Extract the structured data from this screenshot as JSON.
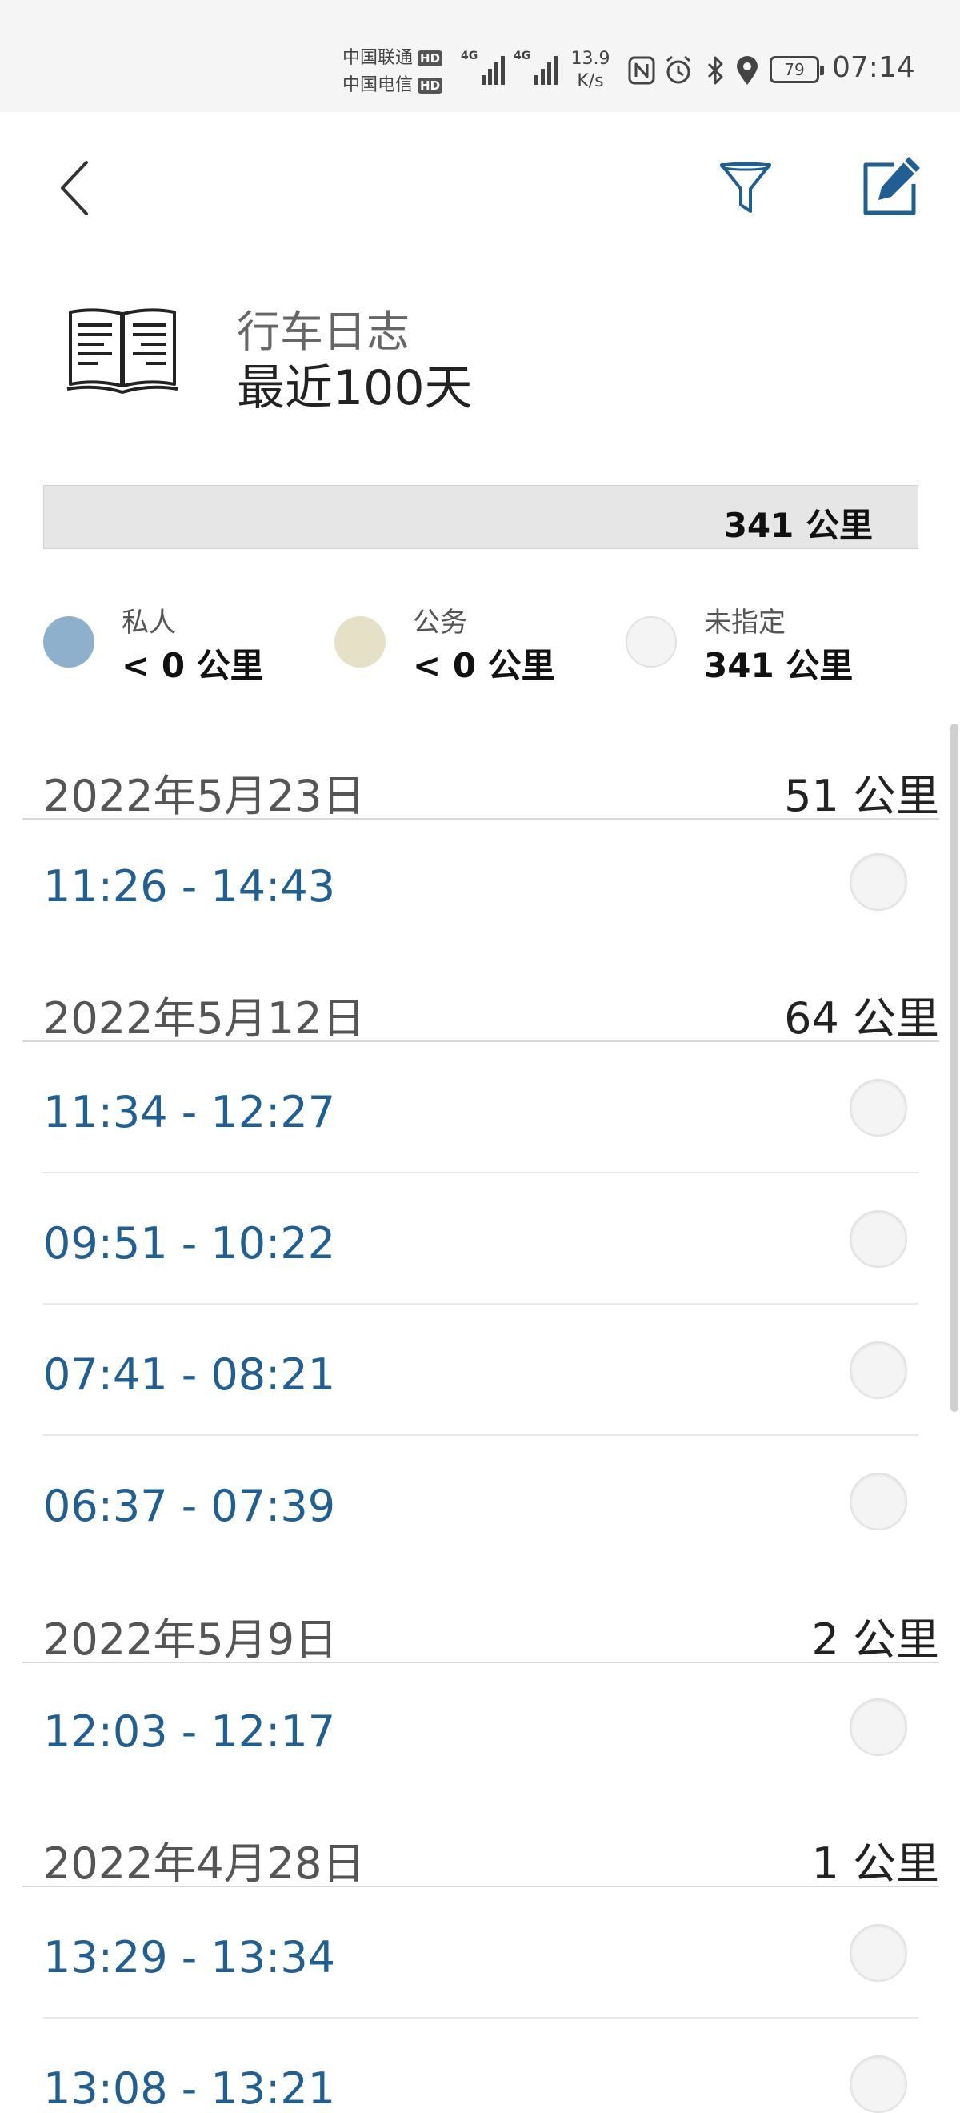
{
  "status_bar": {
    "carrier1": "中国联通",
    "carrier2": "中国电信",
    "hd_badge": "HD",
    "network": "4G",
    "net_speed_value": "13.9",
    "net_speed_unit": "K/s",
    "battery": "79",
    "time": "07:14",
    "icons": [
      "nfc-icon",
      "alarm-icon",
      "bluetooth-icon",
      "location-icon",
      "battery-icon"
    ]
  },
  "nav": {
    "back_icon": "chevron-left-icon",
    "filter_icon": "filter-icon",
    "edit_icon": "edit-icon"
  },
  "header": {
    "icon": "book-icon",
    "title": "行车日志",
    "subtitle": "最近100天"
  },
  "summary": {
    "total": "341 公里"
  },
  "legend": [
    {
      "label": "私人",
      "value": "< 0 公里",
      "color": "#8fb0cc"
    },
    {
      "label": "公务",
      "value": "< 0 公里",
      "color": "#e6e1c6"
    },
    {
      "label": "未指定",
      "value": "341 公里",
      "color": "#f4f4f4"
    }
  ],
  "days": [
    {
      "date": "2022年5月23日",
      "distance": "51 公里",
      "trips": [
        "11:26 - 14:43"
      ]
    },
    {
      "date": "2022年5月12日",
      "distance": "64 公里",
      "trips": [
        "11:34 - 12:27",
        "09:51 - 10:22",
        "07:41 - 08:21",
        "06:37 - 07:39"
      ]
    },
    {
      "date": "2022年5月9日",
      "distance": "2 公里",
      "trips": [
        "12:03 - 12:17"
      ]
    },
    {
      "date": "2022年4月28日",
      "distance": "1 公里",
      "trips": [
        "13:29 - 13:34",
        "13:08 - 13:21"
      ]
    }
  ],
  "colors": {
    "accent_blue": "#1f5f94",
    "status_bar_bg": "#f5f5f5",
    "total_bar_bg": "#e6e6e6"
  }
}
